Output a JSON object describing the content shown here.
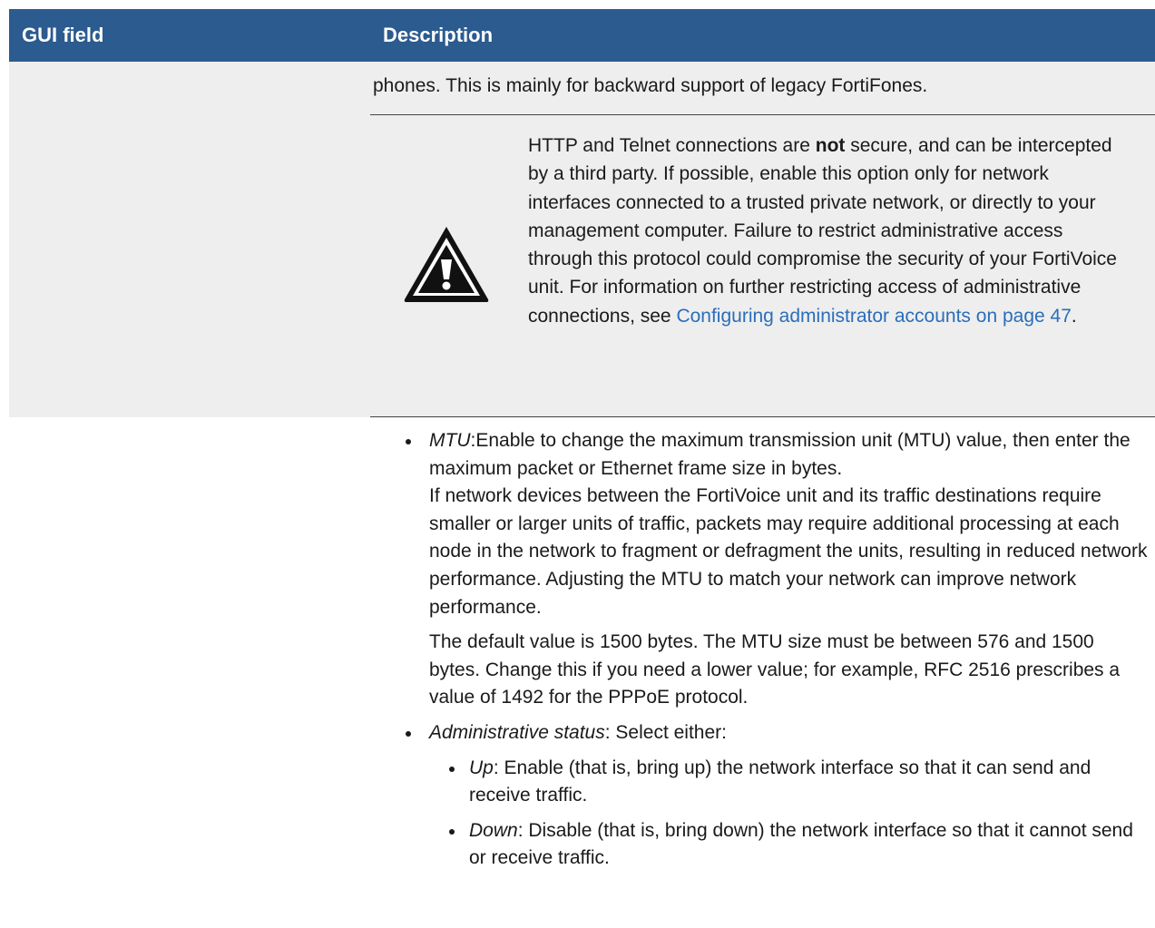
{
  "header": {
    "col1": "GUI field",
    "col2": "Description"
  },
  "row1": {
    "intro": "phones. This is mainly for backward support of legacy FortiFones.",
    "warning": {
      "text_pre": "HTTP and Telnet connections are ",
      "text_bold": "not",
      "text_mid": " secure, and can be intercepted by a third party. If possible, enable this option only for network interfaces connected to a trusted private network, or directly to your management computer. Failure to restrict administrative access through this protocol could compromise the security of your FortiVoice unit. For information on further restricting access of administrative connections, see ",
      "link": "Configuring administrator accounts on page 47",
      "text_end": "."
    }
  },
  "row2": {
    "mtu": {
      "term": "MTU",
      "desc": ":Enable to change the maximum transmission unit (MTU) value, then enter the maximum packet or Ethernet frame size in bytes.",
      "para1": "If network devices between the FortiVoice unit and its traffic destinations require smaller or larger units of traffic, packets may require additional processing at each node in the network to fragment or defragment the units, resulting in reduced network performance. Adjusting the MTU to match your network can improve network performance.",
      "para2": "The default value is 1500 bytes. The MTU size must be between 576 and 1500 bytes. Change this if you need a lower value; for example, RFC 2516 prescribes a value of 1492 for the PPPoE protocol."
    },
    "admin_status": {
      "term": "Administrative status",
      "desc": ": Select either:",
      "options": [
        {
          "term": "Up",
          "desc": ": Enable (that is, bring up) the network interface so that it can send and receive traffic."
        },
        {
          "term": "Down",
          "desc": ": Disable (that is, bring down) the network interface so that it cannot send or receive traffic."
        }
      ]
    }
  },
  "icons": {
    "warning": "warning-icon"
  }
}
